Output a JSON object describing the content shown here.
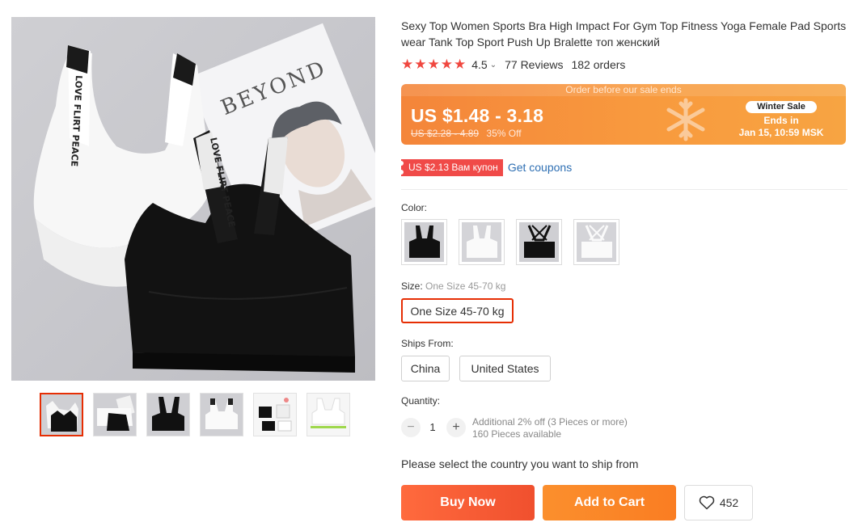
{
  "product": {
    "title": "Sexy Top Women Sports Bra High Impact For Gym Top Fitness Yoga Female Pad Sportswear Tank Top Sport Push Up Bralette топ женский",
    "rating": "4.5",
    "rating_fraction": 0.9,
    "reviews": "77 Reviews",
    "orders": "182 orders",
    "gallery_magazine_text": "BEYOND",
    "strap_text": "LOVE FLIRT PEACE"
  },
  "price": {
    "banner_top": "Order before our sale ends",
    "current": "US $1.48 - 3.18",
    "original": "US $2.28 - 4.89",
    "discount": "35% Off",
    "sale_badge": "Winter Sale",
    "ends_label": "Ends in",
    "ends_date": "Jan 15, 10:59 MSK"
  },
  "coupon": {
    "tag": "US $2.13 Вам купон",
    "link": "Get coupons"
  },
  "color": {
    "label": "Color:",
    "options": [
      "black",
      "white",
      "black",
      "white"
    ]
  },
  "size": {
    "label": "Size: ",
    "selected": "One Size 45-70 kg",
    "button": "One Size 45-70 kg"
  },
  "ships": {
    "label": "Ships From:",
    "options": [
      "China",
      "United States"
    ]
  },
  "quantity": {
    "label": "Quantity:",
    "minus": "−",
    "value": "1",
    "plus": "+",
    "discount_note": "Additional 2% off (3 Pieces or more)",
    "available": "160 Pieces available"
  },
  "ship_note": "Please select the country you want to ship from",
  "actions": {
    "buy": "Buy Now",
    "cart": "Add to Cart",
    "wishlist_count": "452"
  },
  "colors": {
    "accent": "#e62e04",
    "banner_start": "#f4853a",
    "buy_btn": "#f0502e",
    "cart_btn": "#fa7d22",
    "coupon_bg": "#f04a48",
    "link": "#2e6fb3",
    "star": "#f0473f"
  }
}
